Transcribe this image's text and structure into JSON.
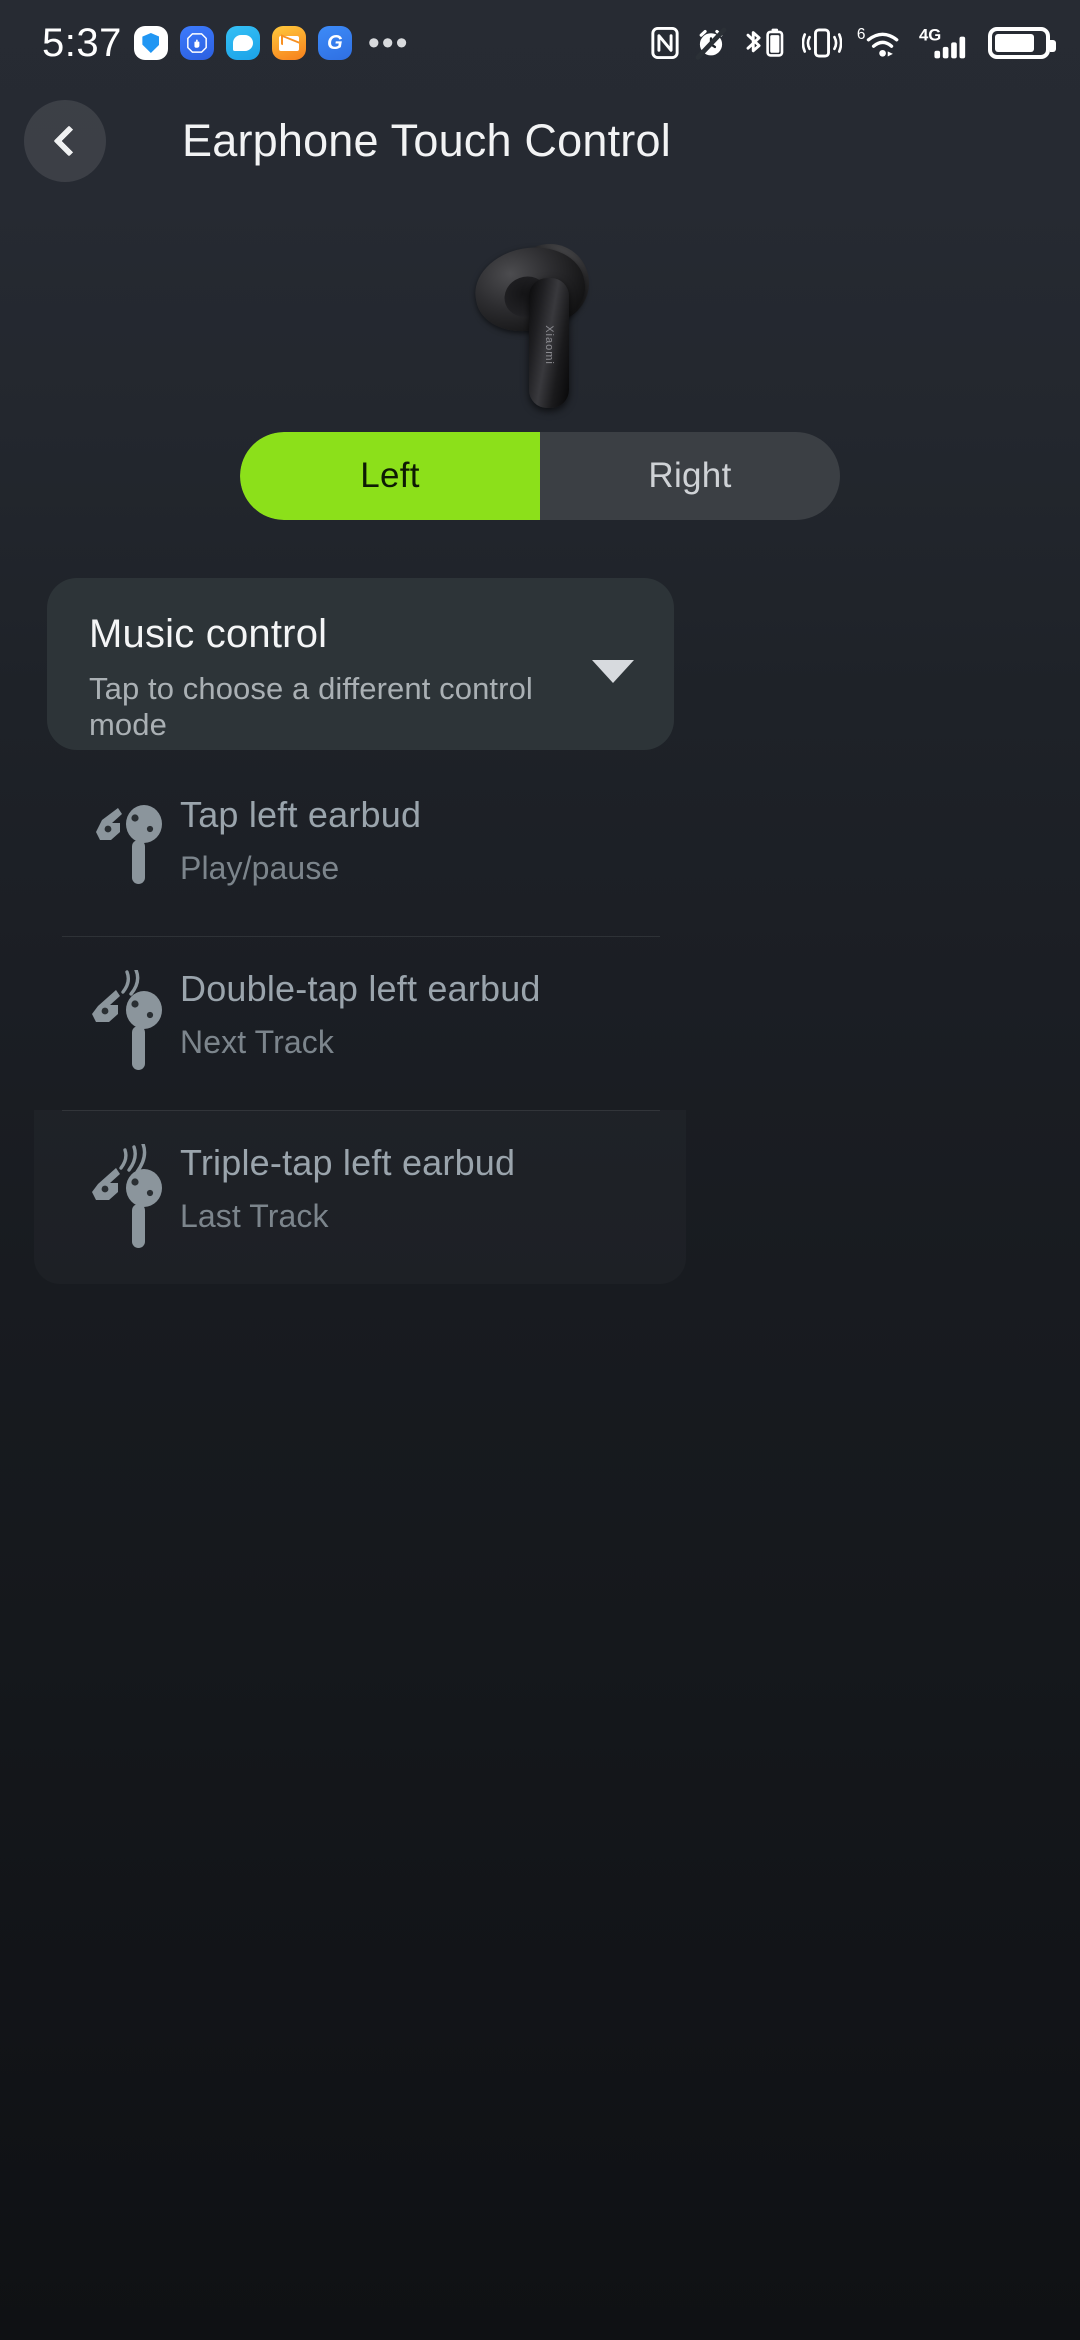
{
  "statusbar": {
    "time": "5:37",
    "notification_icons": [
      {
        "name": "security-shield-icon",
        "glyph": ""
      },
      {
        "name": "blocker-hand-icon",
        "glyph": "✋"
      },
      {
        "name": "messages-chat-icon",
        "glyph": ""
      },
      {
        "name": "email-icon",
        "glyph": ""
      },
      {
        "name": "app-g-icon",
        "glyph": "G"
      }
    ],
    "overflow": "•••",
    "system_icons": [
      "nfc-icon",
      "alarm-off-icon",
      "bluetooth-battery-icon",
      "vibrate-icon",
      "wifi-6-icon",
      "4g-signal-icon",
      "battery-icon"
    ],
    "wifi_generation": "6",
    "network_type": "4G",
    "battery_level_percent": 82
  },
  "appbar": {
    "back_label": "Back",
    "title": "Earphone Touch Control"
  },
  "hero": {
    "device_brand": "Xiaomi",
    "alt": "Black wireless earbud"
  },
  "side_toggle": {
    "options": [
      {
        "label": "Left",
        "selected": true
      },
      {
        "label": "Right",
        "selected": false
      }
    ],
    "accent_color": "#8CE01A"
  },
  "mode_card": {
    "title": "Music control",
    "subtitle": "Tap to choose a different control mode",
    "caret": "▼"
  },
  "actions": [
    {
      "icon": "tap-earbud-icon",
      "gesture": "Tap left earbud",
      "action": "Play/pause",
      "waves": 0,
      "divider_above": false,
      "highlighted": false
    },
    {
      "icon": "double-tap-earbud-icon",
      "gesture": "Double-tap left earbud",
      "action": "Next Track",
      "waves": 2,
      "divider_above": true,
      "highlighted": false
    },
    {
      "icon": "triple-tap-earbud-icon",
      "gesture": "Triple-tap left earbud",
      "action": "Last Track",
      "waves": 3,
      "divider_above": true,
      "highlighted": true
    }
  ],
  "colors": {
    "background": "#1B1F24",
    "card": "#2D3438",
    "accent_green": "#8CE01A",
    "text_primary": "#F2F3F4",
    "text_secondary": "#AAB0B4",
    "text_muted": "#7C858C"
  }
}
